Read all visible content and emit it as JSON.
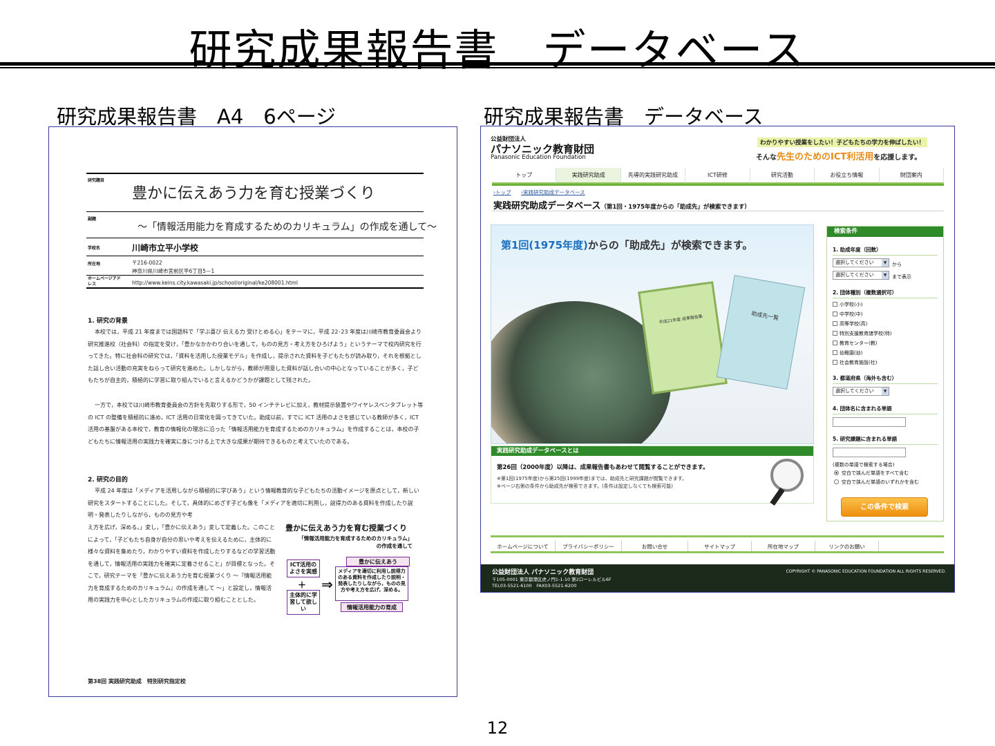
{
  "slide": {
    "title": "研究成果報告書　データベース",
    "left_caption": "研究成果報告書　A4　6ページ",
    "right_caption": "研究成果報告書　データベース",
    "page_number": "12"
  },
  "report": {
    "label_theme": "研究題目",
    "title": "豊かに伝えあう力を育む授業づくり",
    "label_subtitle": "副題",
    "subtitle": "～「情報活用能力を育成するためのカリキュラム」の作成を通して～",
    "label_school": "学校名",
    "school": "川崎市立平小学校",
    "label_address": "所在地",
    "postal": "〒216-0022",
    "address": "神奈川県川崎市宮前区平6丁目5－1",
    "label_homepage": "ホームページアドレス",
    "url": "http://www.keins.city.kawasaki.jp/school/original/ke208001.html",
    "heading1": "1. 研究の背景",
    "para1": "本校では，平成 21 年度までは国語科で「学ぶ喜び 伝える力 受けとめる心」をテーマに，平成 22･23 年度は川崎市教育委員会より研究推進校（社会科）の指定を受け，「豊かなかかわり合いを通して，ものの見方・考え方をひろげよう」というテーマで校内研究を行ってきた。特に社会科の研究では，「資料を活用した授業モデル」を作成し，提示された資料を子どもたちが読み取り，それを根拠とした話し合い活動の充実をねらって研究を進めた。しかしながら，教師が用意した資料が話し合いの中心となっていることが多く，子どもたちが自主的，積極的に学習に取り組んでいると言えるかどうかが課題として残された。",
    "para2": "一方で，本校では川崎市教育委員会の方針を先取りする形で，50 インチテレビに加え，教材提示装置やワイヤレスペンタブレット等の ICT の整備を積極的に進め，ICT 活用の日常化を図ってきていた。助成以前，すでに ICT 活用のよさを感じている教師が多く，ICT 活用の基盤がある本校で，教育の情報化の理念に沿った「情報活用能力を育成するためのカリキュラム」を作成することは，本校の子どもたちに情報活用の実践力を確実に身につける上で大きな成果が期待できるものと考えていたのである。",
    "heading2": "2. 研究の目的",
    "para3": "平成 24 年度は「メディアを活用しながら積極的に学びあう」という情報教育的な子どもたちの活動イメージを原点として，新しい研究をスタートすることにした。そして，具体的にめざす子ども像を「メディアを適切に利用し，説得力のある資料を作成したり説明・発表したりしながら，ものの見方や考",
    "para4": "え方を広げ，深める。」変し，「豊かに伝えあう」変して定義した。このことによって，「子どもたち自身が自分の思いや考えを伝えるために，主体的に様々な資料を集めたり，わかりやすい資料を作成したりするなどの学習活動を通して，情報活用の実践力を確実に定着させること」が目標となった。そこで，研究テーマを「豊かに伝えあう力を育む授業づくり ～『情報活用能力を育成するためのカリキュラム』の作成を通して ～」と設定し，情報活用の実践力を中心としたカリキュラムの作成に取り組むこととした。",
    "figure": {
      "title": "豊かに伝えあう力を育む授業づくり",
      "subtitle_1": "「情報活用能力を育成するためのカリキュラム」",
      "subtitle_2": "の作成を通して",
      "box_ict": "ICT活用のよさを実感",
      "plus": "＋",
      "box_proactive": "主体的に学習して欲しい",
      "arrow": "⇒",
      "box_goal_head": "豊かに伝えあう",
      "box_goal_body": "メディアを適切に利用し説得力のある資料を作成したり説明・発表したりしながら，ものの見方や考え方を広げ，深める。",
      "box_goal_foot": "情報活用能力の育成"
    },
    "footer": "第38回 実践研究助成　特別研究指定校"
  },
  "web": {
    "org_sub": "公益財団法人",
    "org_name": "パナソニック教育財団",
    "org_en": "Panasonic Education Foundation",
    "tagline1": "わかりやすい授業をしたい！子どもたちの学力を伸ばしたい！",
    "tagline2_pre": "そんな",
    "tagline2_hl1": "先生のための",
    "tagline2_hl2": "ICT利活用",
    "tagline2_post": "を応援します。",
    "nav": [
      "トップ",
      "実践研究助成",
      "先導的実践研究助成",
      "ICT研修",
      "研究活動",
      "お役立ち情報",
      "財団案内"
    ],
    "breadcrumb_home": "›トップ",
    "breadcrumb_current": "›実践研究助成データベース",
    "page_heading": "実践研究助成データベース",
    "page_heading_note": "（第1回・1975年度からの「助成先」が検索できます）",
    "hero_caption_blue": "第1回(1975年度)",
    "hero_caption_rest": "からの「助成先」が検索できます。",
    "book1_text": "平成21年度 成果報告集",
    "book2_text": "助成先一覧",
    "about_head": "実践研究助成データベースとは",
    "about_main": "第26回（2000年度）以降は、成果報告書もあわせて閲覧することができます。",
    "about_note1": "※第1回(1975年度)から第25回(1999年度)までは、助成先と研究課題が閲覧できます。",
    "about_note2": "※ページ右側の条件から助成先が検索できます。(条件は設定しなくても検索可能)",
    "search": {
      "head": "検索条件",
      "year_label": "1. 助成年度（回数）",
      "select_placeholder": "選択してください",
      "from": "から",
      "to_display": "まで表示",
      "type_label": "2. 団体種別（複数選択可）",
      "types": [
        "小学校(小)",
        "中学校(中)",
        "高等学校(高)",
        "特別支援教育諸学校(特)",
        "教育センター(教)",
        "幼稚園(幼)",
        "社会教育施設(社)"
      ],
      "pref_label": "3. 都道府県（海外も含む）",
      "org_word_label": "4. 団体名に含まれる単語",
      "theme_word_label": "5. 研究課題に含まれる単語",
      "multi_note": "(複数の単語で検索する場合)",
      "radio_all": "空白で挟んだ単語をすべて含む",
      "radio_any": "空白で挟んだ単語のいずれかを含む",
      "submit": "この条件で検索"
    },
    "footer_nav": [
      "ホームページについて",
      "プライバシーポリシー",
      "お問い合せ",
      "サイトマップ",
      "所在地マップ",
      "リンクのお願い"
    ],
    "footer_org": "公益財団法人 パナソニック教育財団",
    "footer_addr": "〒105-0001 東京都港区虎ノ門1-1-10 第2ローレルビル6F",
    "footer_tel": "TEL03-5521-6100　FAX03-5521-6200",
    "copyright": "COPYRIGHT © PANASONIC EDUCATION FOUNDATION ALL RIGHTS RESERVED."
  }
}
